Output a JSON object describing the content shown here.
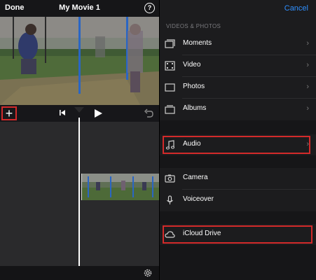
{
  "header": {
    "done_label": "Done",
    "title": "My Movie 1",
    "help_icon": "?"
  },
  "toolbar": {
    "add_icon": "+"
  },
  "picker": {
    "cancel_label": "Cancel",
    "section_title": "VIDEOS & PHOTOS",
    "items": [
      {
        "label": "Moments",
        "icon": "moments-icon",
        "chevron": "›"
      },
      {
        "label": "Video",
        "icon": "film-icon",
        "chevron": "›"
      },
      {
        "label": "Photos",
        "icon": "photos-icon",
        "chevron": "›"
      },
      {
        "label": "Albums",
        "icon": "albums-icon",
        "chevron": "›"
      }
    ],
    "audio": {
      "label": "Audio",
      "icon": "music-note-icon",
      "chevron": "›"
    },
    "media": [
      {
        "label": "Camera",
        "icon": "camera-icon"
      },
      {
        "label": "Voiceover",
        "icon": "microphone-icon"
      }
    ],
    "icloud": {
      "label": "iCloud Drive",
      "icon": "cloud-icon"
    }
  },
  "colors": {
    "accent": "#2f8fff",
    "highlight": "#d32a2a",
    "background": "#1c1c1e"
  }
}
